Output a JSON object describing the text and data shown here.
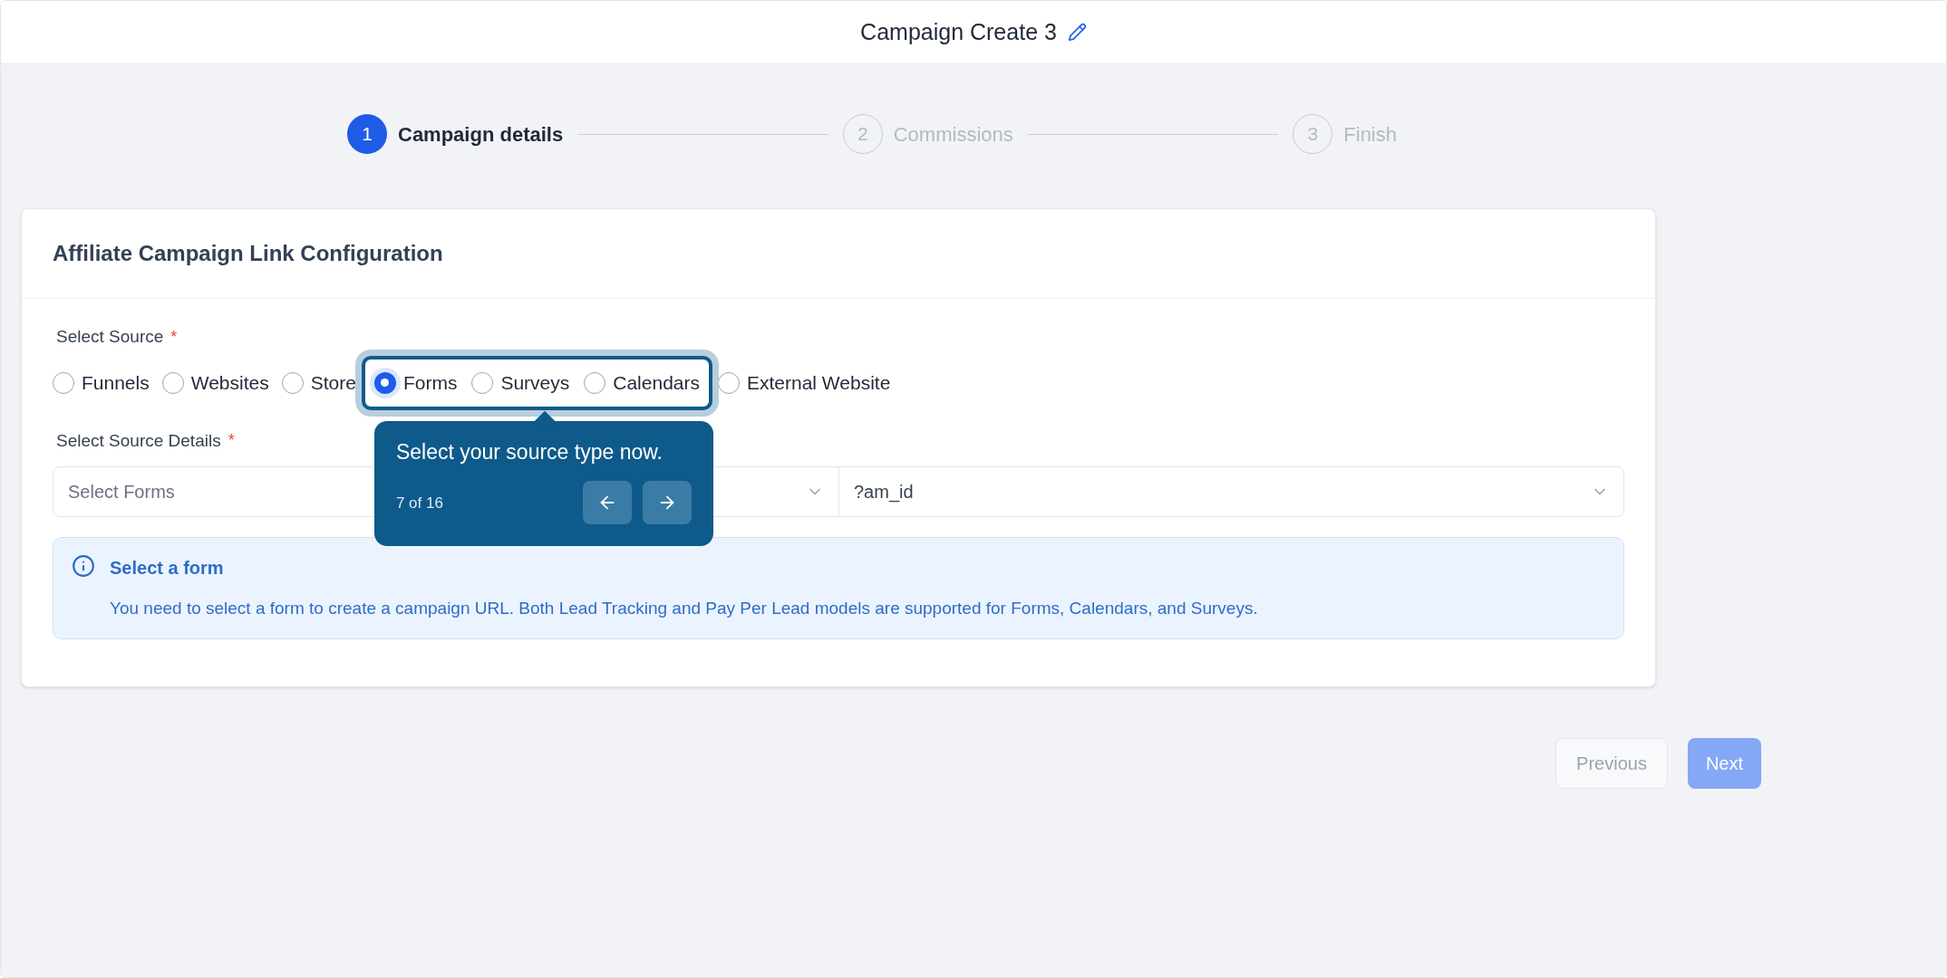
{
  "header": {
    "title": "Campaign Create 3"
  },
  "steps": [
    {
      "number": "1",
      "label": "Campaign details",
      "selected": true
    },
    {
      "number": "2",
      "label": "Commissions",
      "selected": false
    },
    {
      "number": "3",
      "label": "Finish",
      "selected": false
    }
  ],
  "card": {
    "title": "Affiliate Campaign Link Configuration",
    "source_label": "Select Source",
    "source_required": "*",
    "sources": [
      {
        "label": "Funnels",
        "selected": false,
        "highlighted": false
      },
      {
        "label": "Websites",
        "selected": false,
        "highlighted": false
      },
      {
        "label": "Store",
        "selected": false,
        "highlighted": false
      },
      {
        "label": "Forms",
        "selected": true,
        "highlighted": true
      },
      {
        "label": "Surveys",
        "selected": false,
        "highlighted": true
      },
      {
        "label": "Calendars",
        "selected": false,
        "highlighted": true
      },
      {
        "label": "External Website",
        "selected": false,
        "highlighted": false
      }
    ],
    "details_label": "Select Source Details",
    "details_required": "*",
    "details_select": {
      "placeholder": "Select Forms"
    },
    "param_select": {
      "value": "?am_id"
    },
    "info": {
      "title": "Select a form",
      "text": "You need to select a form to create a campaign URL. Both Lead Tracking and Pay Per Lead models are supported for Forms, Calendars, and Surveys."
    }
  },
  "tour": {
    "text": "Select your source type now.",
    "counter": "7 of 16"
  },
  "buttons": [
    {
      "label": "Previous",
      "kind": "secondary"
    },
    {
      "label": "Next",
      "kind": "primary"
    }
  ]
}
